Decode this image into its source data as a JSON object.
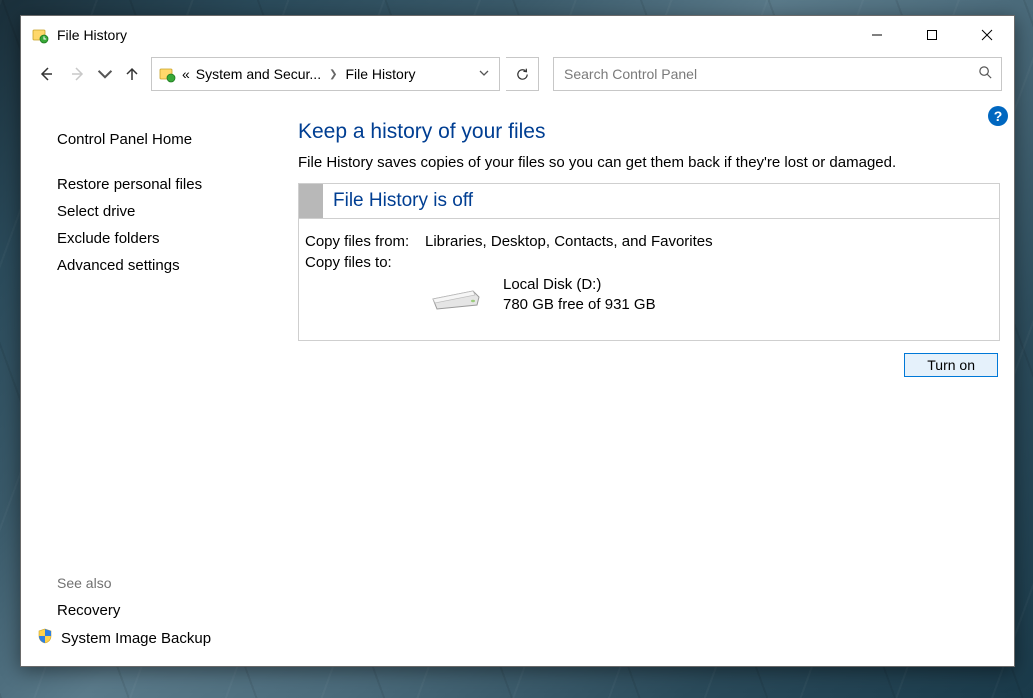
{
  "titlebar": {
    "title": "File History"
  },
  "breadcrumb": {
    "root_short": "«",
    "segment1": "System and Secur...",
    "segment2": "File History"
  },
  "search": {
    "placeholder": "Search Control Panel"
  },
  "sidebar": {
    "home": "Control Panel Home",
    "links": [
      "Restore personal files",
      "Select drive",
      "Exclude folders",
      "Advanced settings"
    ],
    "see_also_label": "See also",
    "see_also": [
      "Recovery",
      "System Image Backup"
    ]
  },
  "main": {
    "title": "Keep a history of your files",
    "subtitle": "File History saves copies of your files so you can get them back if they're lost or damaged.",
    "status_heading": "File History is off",
    "copy_from_label": "Copy files from:",
    "copy_from_value": "Libraries, Desktop, Contacts, and Favorites",
    "copy_to_label": "Copy files to:",
    "drive_name": "Local Disk (D:)",
    "drive_free": "780 GB free of 931 GB",
    "turn_on_label": "Turn on",
    "help_symbol": "?"
  }
}
